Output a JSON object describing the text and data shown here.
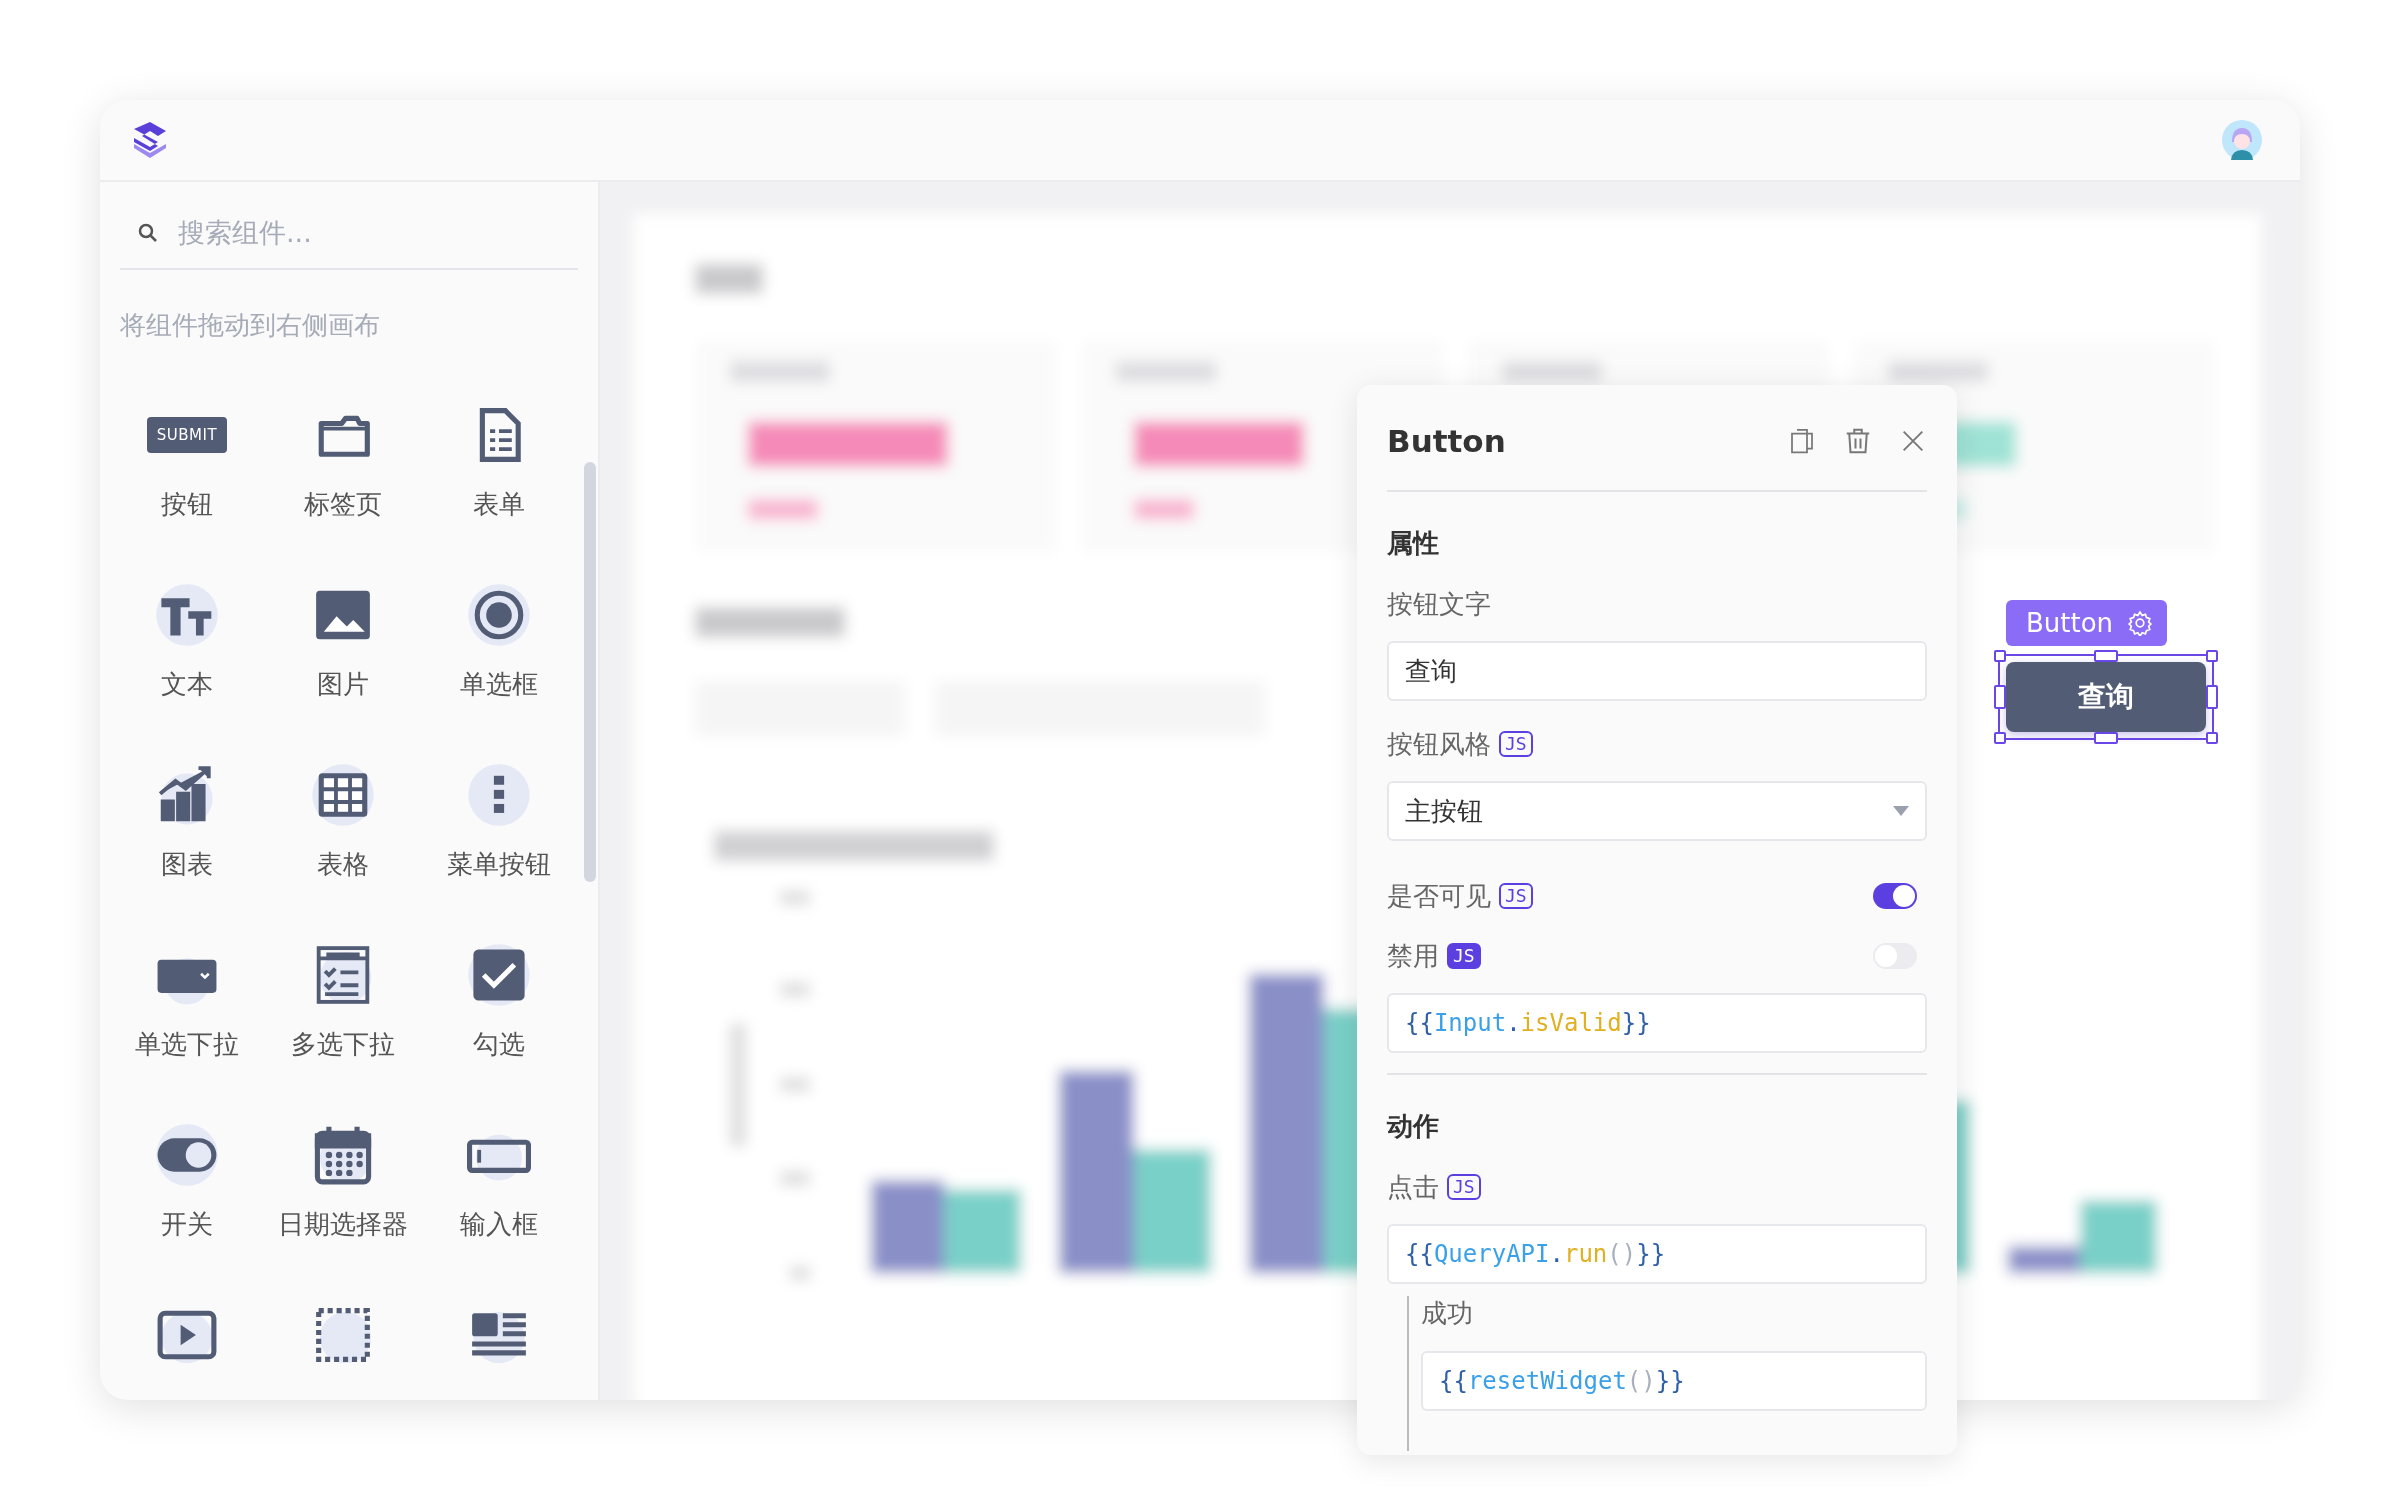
{
  "sidebar": {
    "search": {
      "placeholder": "搜索组件..."
    },
    "hint": "将组件拖动到右侧画布",
    "components": [
      {
        "kind": "button",
        "label": "按钮",
        "badge": "SUBMIT"
      },
      {
        "kind": "tabs",
        "label": "标签页"
      },
      {
        "kind": "form",
        "label": "表单"
      },
      {
        "kind": "text",
        "label": "文本"
      },
      {
        "kind": "image",
        "label": "图片"
      },
      {
        "kind": "radio",
        "label": "单选框"
      },
      {
        "kind": "chart",
        "label": "图表"
      },
      {
        "kind": "table",
        "label": "表格"
      },
      {
        "kind": "menu",
        "label": "菜单按钮"
      },
      {
        "kind": "dropdown",
        "label": "单选下拉"
      },
      {
        "kind": "multiselect",
        "label": "多选下拉"
      },
      {
        "kind": "checkbox",
        "label": "勾选"
      },
      {
        "kind": "switch",
        "label": "开关"
      },
      {
        "kind": "date",
        "label": "日期选择器"
      },
      {
        "kind": "input",
        "label": "输入框"
      },
      {
        "kind": "video"
      },
      {
        "kind": "container"
      },
      {
        "kind": "richtext"
      }
    ]
  },
  "selected_widget": {
    "tag": "Button",
    "label": "查询"
  },
  "property_panel": {
    "title": "Button",
    "sections": [
      {
        "title": "属性",
        "fields": [
          {
            "kind": "text",
            "label": "按钮文字",
            "value": "查询"
          },
          {
            "kind": "select",
            "label": "按钮风格",
            "js": {
              "text": "JS",
              "filled": false
            },
            "value": "主按钮"
          },
          {
            "kind": "toggle",
            "label": "是否可见",
            "js": {
              "text": "JS",
              "filled": false
            },
            "on": true
          },
          {
            "kind": "code",
            "label": "禁用",
            "js": {
              "text": "JS",
              "filled": true
            },
            "on": false,
            "code": "{{Input.isValid}}"
          }
        ]
      },
      {
        "title": "动作",
        "fields": [
          {
            "kind": "code",
            "label": "点击",
            "js": {
              "text": "JS",
              "filled": false
            },
            "code": "{{QueryAPI.run()}}",
            "children": [
              {
                "label": "成功",
                "code": "{{resetWidget()}}"
              }
            ]
          }
        ]
      }
    ]
  }
}
